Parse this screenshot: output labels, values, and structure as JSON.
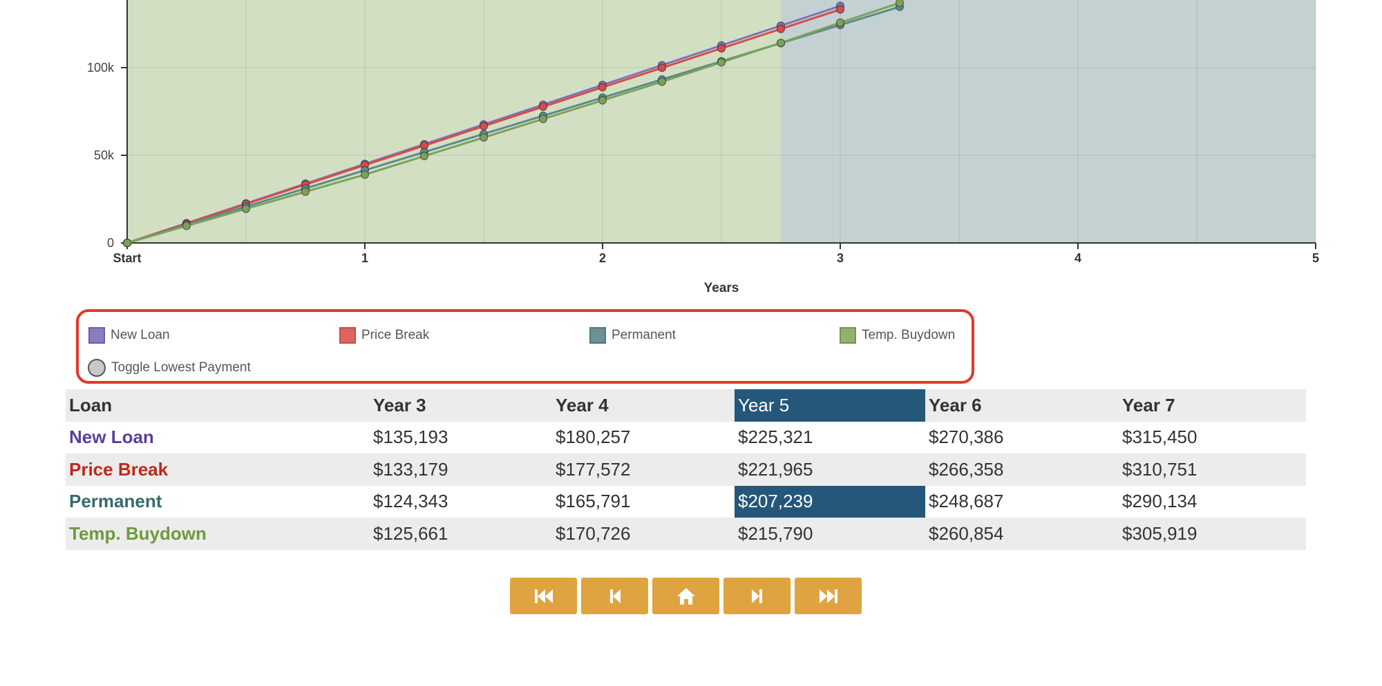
{
  "chart_data": {
    "type": "line",
    "xlabel": "Years",
    "ylabel": "",
    "x_ticks": [
      "Start",
      "1",
      "2",
      "3",
      "4",
      "5"
    ],
    "y_ticks": [
      "0",
      "50k",
      "100k"
    ],
    "xlim": [
      0,
      5
    ],
    "visible_ylim": [
      0,
      140000
    ],
    "grid": true,
    "highlight_regions": [
      {
        "from": 0,
        "to": 2.75,
        "color": "#d2dfc3"
      },
      {
        "from": 2.75,
        "to": 5,
        "color": "#c3d1d2"
      }
    ],
    "series": [
      {
        "name": "New Loan",
        "color": "#8172b7",
        "x": [
          0,
          0.25,
          0.5,
          0.75,
          1,
          1.25,
          1.5,
          1.75,
          2,
          2.25,
          2.5,
          2.75,
          3
        ],
        "values": [
          0,
          11266,
          22532,
          33798,
          45064,
          56330,
          67596,
          78862,
          90129,
          101395,
          112661,
          123927,
          135193
        ]
      },
      {
        "name": "Price Break",
        "color": "#d94b45",
        "x": [
          0,
          0.25,
          0.5,
          0.75,
          1,
          1.25,
          1.5,
          1.75,
          2,
          2.25,
          2.5,
          2.75,
          3
        ],
        "values": [
          0,
          11098,
          22197,
          33295,
          44393,
          55491,
          66590,
          77688,
          88786,
          99884,
          110983,
          122081,
          133179
        ]
      },
      {
        "name": "Permanent",
        "color": "#5b8a8c",
        "x": [
          0,
          0.25,
          0.5,
          0.75,
          1,
          1.25,
          1.5,
          1.75,
          2,
          2.25,
          2.5,
          2.75,
          3,
          3.25
        ],
        "values": [
          0,
          10362,
          20724,
          31086,
          41448,
          51810,
          62172,
          72533,
          82895,
          93257,
          103619,
          113981,
          124343,
          134705
        ]
      },
      {
        "name": "Temp. Buydown",
        "color": "#7ba257",
        "x": [
          0,
          0.25,
          0.5,
          0.75,
          1,
          1.25,
          1.5,
          1.75,
          2,
          2.25,
          2.5,
          2.75,
          3,
          3.25
        ],
        "values": [
          0,
          9741,
          19483,
          29224,
          38966,
          49560,
          60154,
          70748,
          81342,
          91936,
          103020,
          114104,
          125661,
          136927
        ]
      }
    ]
  },
  "legend": {
    "items": [
      {
        "label": "New Loan",
        "color": "#8b7cc0",
        "border": "#6b5ca8"
      },
      {
        "label": "Price Break",
        "color": "#df6660",
        "border": "#c84a45"
      },
      {
        "label": "Permanent",
        "color": "#6d9295",
        "border": "#4e7678"
      },
      {
        "label": "Temp. Buydown",
        "color": "#93b26f",
        "border": "#74964f"
      }
    ],
    "toggle_label": "Toggle Lowest Payment"
  },
  "table": {
    "headers": [
      "Loan",
      "Year 3",
      "Year 4",
      "Year 5",
      "Year 6",
      "Year 7"
    ],
    "rows": [
      {
        "name": "New Loan",
        "color": "#5b3e9c",
        "values": [
          "$135,193",
          "$180,257",
          "$225,321",
          "$270,386",
          "$315,450"
        ]
      },
      {
        "name": "Price Break",
        "color": "#c0271c",
        "values": [
          "$133,179",
          "$177,572",
          "$221,965",
          "$266,358",
          "$310,751"
        ]
      },
      {
        "name": "Permanent",
        "color": "#356a6d",
        "values": [
          "$124,343",
          "$165,791",
          "$207,239",
          "$248,687",
          "$290,134"
        ]
      },
      {
        "name": "Temp. Buydown",
        "color": "#6d9a3c",
        "values": [
          "$125,661",
          "$170,726",
          "$215,790",
          "$260,854",
          "$305,919"
        ]
      }
    ]
  },
  "pager": {
    "buttons": [
      "first-page",
      "previous-page",
      "home",
      "next-page",
      "last-page"
    ]
  }
}
